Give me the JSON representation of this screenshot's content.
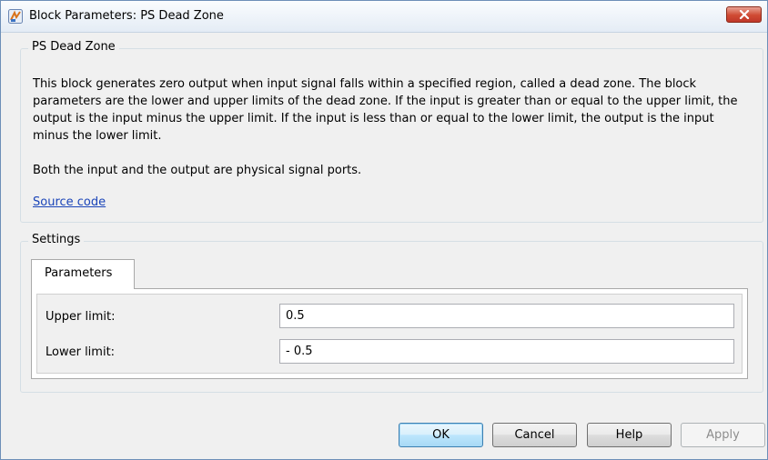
{
  "window": {
    "title": "Block Parameters: PS Dead Zone",
    "icons": {
      "app": "block-parameters-icon",
      "close": "close-icon"
    }
  },
  "description": {
    "group_label": "PS Dead Zone",
    "paragraph1": "This block generates zero output when input signal falls within a specified region, called a dead zone. The block parameters are the lower and upper limits of the dead zone. If the input is greater than or equal to the upper limit, the output is the input minus the upper limit. If the input is less than or equal to the lower limit, the output is the input minus the lower limit.",
    "paragraph2": "Both the input and the output are physical signal ports.",
    "source_link": "Source code"
  },
  "settings": {
    "group_label": "Settings",
    "tabs": [
      {
        "label": "Parameters",
        "selected": true
      }
    ],
    "parameters": [
      {
        "label": "Upper limit:",
        "value": "0.5"
      },
      {
        "label": "Lower limit:",
        "value": "- 0.5"
      }
    ]
  },
  "buttons": {
    "ok": "OK",
    "cancel": "Cancel",
    "help": "Help",
    "apply": "Apply"
  },
  "colors": {
    "link": "#1a44b8",
    "close_button": "#cf4a33",
    "default_button_border": "#3c7fb1"
  }
}
